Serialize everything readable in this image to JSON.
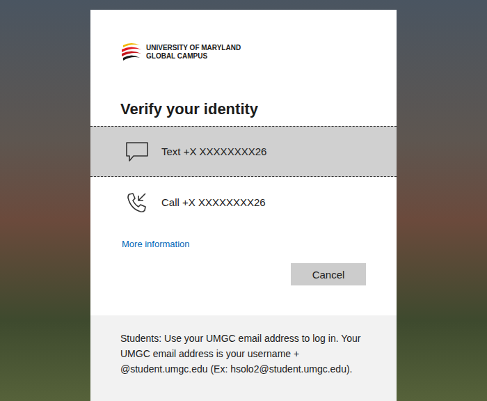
{
  "logo": {
    "line1": "UNIVERSITY OF MARYLAND",
    "line2": "GLOBAL CAMPUS"
  },
  "title": "Verify your identity",
  "options": [
    {
      "label": "Text +X XXXXXXXX26",
      "kind": "text",
      "selected": true
    },
    {
      "label": "Call +X XXXXXXXX26",
      "kind": "call",
      "selected": false
    }
  ],
  "link": "More information",
  "buttons": [
    "Cancel"
  ],
  "footer": "Students: Use your UMGC email address to log in. Your UMGC email address is your username + @student.umgc.edu (Ex: hsolo2@student.umgc.edu)."
}
